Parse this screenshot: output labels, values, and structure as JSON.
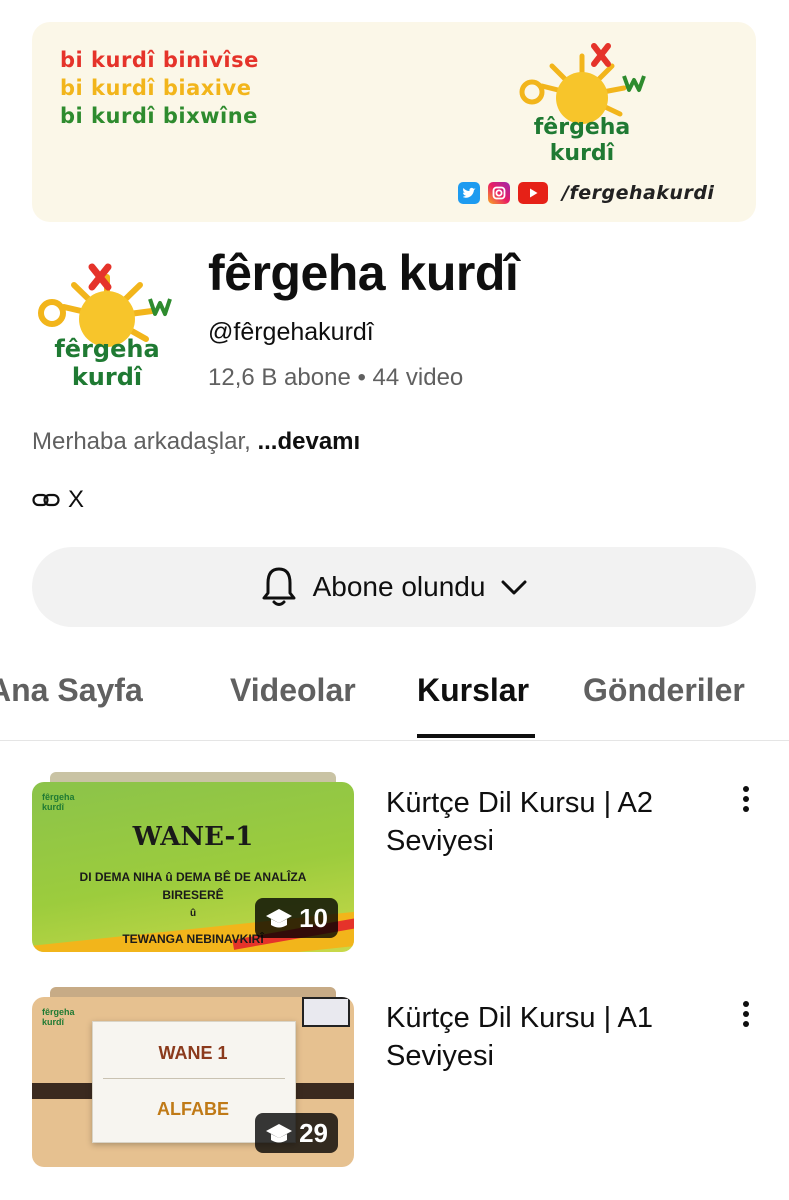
{
  "banner": {
    "slogan_1": "bi kurdî binivîse",
    "slogan_2": "bi kurdî biaxive",
    "slogan_3": "bi kurdî bixwîne",
    "logo_line_1": "fêrgeha",
    "logo_line_2": "kurdî",
    "social_handle": "/fergehakurdi",
    "social_icons": [
      "twitter-icon",
      "instagram-icon",
      "youtube-icon"
    ]
  },
  "channel": {
    "avatar_line_1": "fêrgeha",
    "avatar_line_2": "kurdî",
    "title": "fêrgeha kurdî",
    "handle": "@fêrgehakurdî",
    "meta": "12,6 B abone • 44 video",
    "description": "Merhaba arkadaşlar, ",
    "more_label": "...devamı",
    "link_label": "X"
  },
  "subscribe": {
    "label": "Abone olundu",
    "icon": "bell-icon",
    "caret": "chevron-down-icon"
  },
  "tabs": [
    {
      "label": "Ana Sayfa",
      "active": false
    },
    {
      "label": "Videolar",
      "active": false
    },
    {
      "label": "Kurslar",
      "active": true
    },
    {
      "label": "Gönderiler",
      "active": false
    }
  ],
  "courses": [
    {
      "title": "Kürtçe Dil Kursu | A2 Seviyesi",
      "count": "10",
      "thumb": {
        "logo": "fêrgeha kurdî",
        "heading": "WANE-1",
        "line_1": "DI DEMA NIHA û DEMA BÊ DE ANALÎZA",
        "line_2": "BIRESERÊ",
        "line_3": "û",
        "line_4": "TEWANGA NEBINAVKIRÎ"
      }
    },
    {
      "title": "Kürtçe Dil Kursu | A1 Seviyesi",
      "count": "29",
      "thumb": {
        "logo": "fêrgeha kurdî",
        "heading": "WANE 1",
        "line_1": "ALFABE"
      }
    }
  ],
  "colors": {
    "red": "#e5332a",
    "yellow": "#f2b51b",
    "green": "#2e8b2e",
    "sub_button_bg": "#f2f2f2",
    "secondary_text": "#606060"
  }
}
